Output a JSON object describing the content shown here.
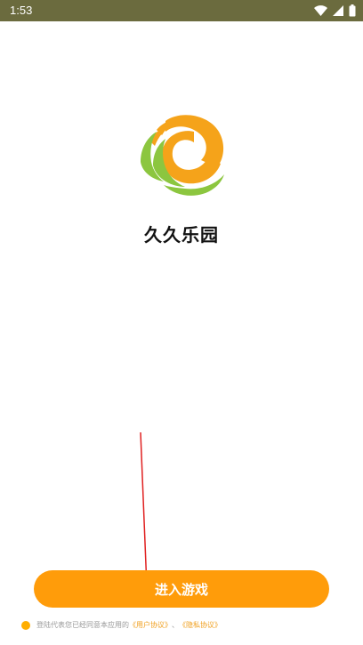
{
  "status_bar": {
    "time": "1:53",
    "icons": [
      "wifi-icon",
      "signal-icon",
      "battery-icon"
    ]
  },
  "app": {
    "name": "久久乐园",
    "logo": "logo-icon"
  },
  "enter_button": {
    "label": "进入游戏"
  },
  "agreement": {
    "text": "登陆代表您已经同意本应用的",
    "user_agreement": "《用户协议》",
    "separator": "、",
    "privacy_policy": "《隐私协议》"
  },
  "colors": {
    "accent": "#ff9c0a",
    "status_bar": "#6b6b3e",
    "logo_orange": "#f5a31a",
    "logo_green": "#8cc63f",
    "link": "#f0a020"
  }
}
